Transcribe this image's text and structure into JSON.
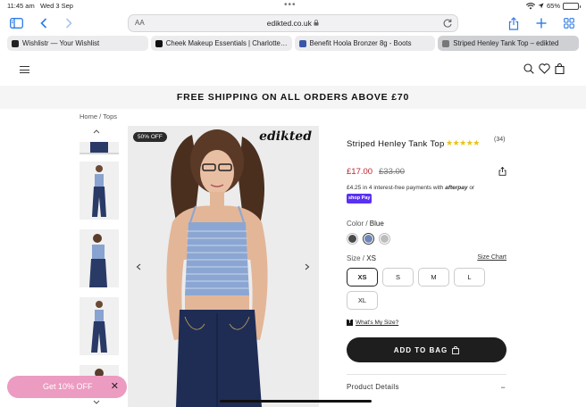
{
  "status": {
    "time": "11:45 am",
    "date": "Wed 3 Sep",
    "battery_text": "65%",
    "battery_level": 0.65
  },
  "browser": {
    "address_aa": "AA",
    "url": "edikted.co.uk",
    "tabs": [
      {
        "label": "Wishlistr — Your Wishlist",
        "fav_color": "#222222"
      },
      {
        "label": "Cheek Makeup Essentials | Charlotte…",
        "fav_color": "#111111"
      },
      {
        "label": "Benefit Hoola Bronzer 8g - Boots",
        "fav_color": "#3b56a8"
      },
      {
        "label": "Striped Henley Tank Top – edikted",
        "fav_color": "#777777"
      }
    ]
  },
  "site": {
    "banner": "FREE SHIPPING ON ALL ORDERS ABOVE £70",
    "breadcrumb": {
      "home": "Home",
      "sep": "/",
      "current": "Tops"
    }
  },
  "gallery": {
    "badge": "50% OFF",
    "brand_logo": "edikted"
  },
  "product": {
    "title": "Striped Henley Tank Top",
    "rating_stars": 5,
    "rating_count": "(34)",
    "price": "£17.00",
    "old_price": "£33.00",
    "installments": "£4.25 in 4 interest-free payments with",
    "afterpay": "afterpay",
    "or_text": "or",
    "shoppay": "shop Pay",
    "color_label": "Color",
    "color_value": "Blue",
    "colors": [
      "#4a4a4a",
      "#6f86b8",
      "#bcbcbc"
    ],
    "size_label": "Size",
    "size_value": "XS",
    "size_chart": "Size Chart",
    "sizes": [
      "XS",
      "S",
      "M",
      "L",
      "XL"
    ],
    "whats_my_size": "What's My Size?",
    "add_to_bag": "ADD TO BAG",
    "details": "Product Details",
    "details_toggle": "−"
  },
  "promo": {
    "text": "Get 10% OFF",
    "close": "✕"
  }
}
